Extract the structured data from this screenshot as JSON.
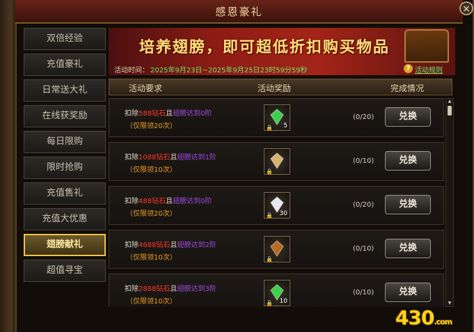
{
  "window": {
    "title": "感恩豪礼",
    "close_icon": "×"
  },
  "sidebar": {
    "items": [
      {
        "label": "双倍经验",
        "active": false
      },
      {
        "label": "充值豪礼",
        "active": false
      },
      {
        "label": "日常送大礼",
        "active": false
      },
      {
        "label": "在线获奖励",
        "active": false
      },
      {
        "label": "每日限购",
        "active": false
      },
      {
        "label": "限时抢购",
        "active": false
      },
      {
        "label": "充值售礼",
        "active": false
      },
      {
        "label": "充值大优惠",
        "active": false
      },
      {
        "label": "翅膀献礼",
        "active": true
      },
      {
        "label": "超值寻宝",
        "active": false
      }
    ]
  },
  "banner": {
    "headline": "培养翅膀，即可超低折扣购买物品",
    "time_label": "活动时间：",
    "time_value": "2025年9月23日~2025年9月25日23时59分59秒",
    "help_icon": "?",
    "rules_link": "活动规则"
  },
  "table": {
    "headers": [
      "活动要求",
      "活动奖励",
      "完成情况"
    ],
    "rows": [
      {
        "req_prefix": "扣除",
        "cost": "588钻石",
        "req_mid": "且",
        "cond": "翅膀达到0阶",
        "limit": "（仅限领20次）",
        "item_color": "#3ad04a",
        "item_count": "5",
        "progress": "(0/20)",
        "button": "兑换"
      },
      {
        "req_prefix": "扣除",
        "cost": "1088钻石",
        "req_mid": "且",
        "cond": "翅膀达到1阶",
        "limit": "（仅限领10次）",
        "item_color": "#d8b070",
        "item_count": "",
        "progress": "(0/10)",
        "button": "兑换"
      },
      {
        "req_prefix": "扣除",
        "cost": "488钻石",
        "req_mid": "且",
        "cond": "翅膀达到0阶",
        "limit": "（仅限领20次）",
        "item_color": "#e8e8f0",
        "item_count": "30",
        "progress": "(0/20)",
        "button": "兑换"
      },
      {
        "req_prefix": "扣除",
        "cost": "4688钻石",
        "req_mid": "且",
        "cond": "翅膀达到2阶",
        "limit": "（仅限领10次）",
        "item_color": "#b86a20",
        "item_count": "",
        "progress": "(0/10)",
        "button": "兑换"
      },
      {
        "req_prefix": "扣除",
        "cost": "2888钻石",
        "req_mid": "且",
        "cond": "翅膀达到3阶",
        "limit": "（仅限领10次）",
        "item_color": "#3ad04a",
        "item_count": "10",
        "progress": "(0/10)",
        "button": "兑换"
      }
    ]
  },
  "logo": {
    "main": "430",
    "suffix": ".com"
  }
}
